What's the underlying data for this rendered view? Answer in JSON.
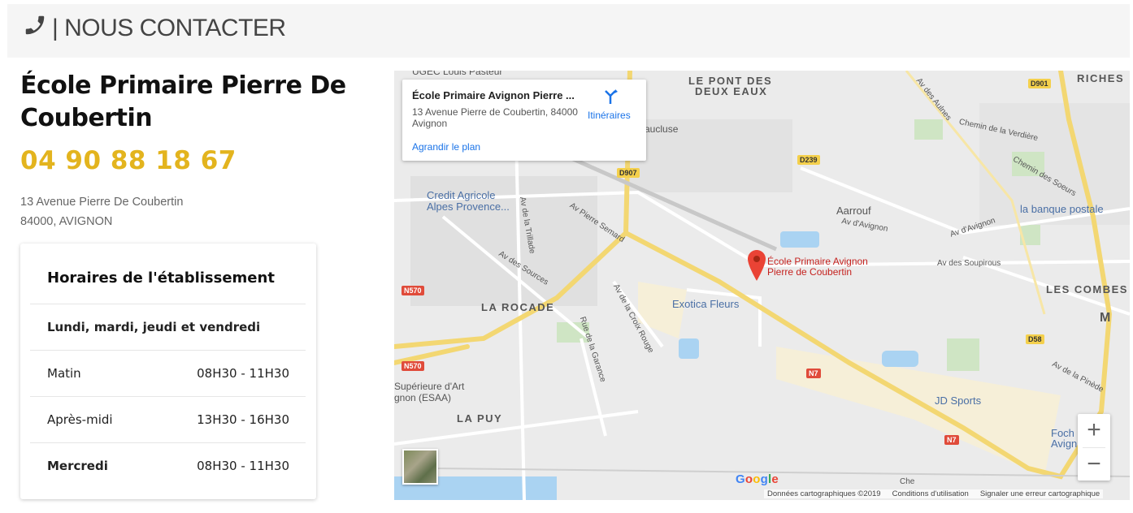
{
  "header": {
    "title": "| NOUS CONTACTER",
    "icon": "phone-icon"
  },
  "school": {
    "name": "École Primaire Pierre De Coubertin",
    "phone": "04 90 88 18 67",
    "address_line1": "13 Avenue Pierre De Coubertin",
    "address_line2": "84000, AVIGNON"
  },
  "hours": {
    "title": "Horaires de l'établissement",
    "section_label": "Lundi, mardi, jeudi et vendredi",
    "rows": [
      {
        "day": "Matin",
        "time": "08H30 - 11H30"
      },
      {
        "day": "Après-midi",
        "time": "13H30 - 16H30"
      },
      {
        "day": "Mercredi",
        "time": "08H30 - 11H30"
      }
    ]
  },
  "map": {
    "info_title": "École Primaire Avignon Pierre ...",
    "info_address": "13 Avenue Pierre de Coubertin, 84000 Avignon",
    "info_link": "Agrandir le plan",
    "directions_label": "Itinéraires",
    "pin_label_1": "École Primaire Avignon",
    "pin_label_2": "Pierre de Coubertin",
    "labels": {
      "le_pont": "LE PONT DES",
      "deux_eaux": "DEUX EAUX",
      "riches": "RICHES",
      "la_rocade": "LA ROCADE",
      "la_puy": "LA PUY",
      "les_combes": "LES COMBES",
      "ugec": "UGEC Louis Pasteur",
      "vaucluse": "aucluse",
      "credit1": "Credit Agricole",
      "credit2": "Alpes Provence...",
      "aarrouf": "Aarrouf",
      "banque": "la banque postale",
      "exotica": "Exotica Fleurs",
      "jd": "JD Sports",
      "foch1": "Foch",
      "foch2": "Avign",
      "esaa1": "Supérieure d'Art",
      "esaa2": "gnon (ESAA)",
      "av_aulnes": "Av des Aulnes",
      "ch_verdiere": "Chemin de la Verdière",
      "ch_soeurs": "Chemin des Soeurs",
      "av_avignon1": "Av d'Avignon",
      "av_avignon2": "Av d'Avignon",
      "av_soupirous": "Av des Soupirous",
      "av_semard": "Av Pierre Semard",
      "av_trillade": "Av de la Trillade",
      "av_sources": "Av des Sources",
      "av_croix": "Av de la Croix Rouge",
      "rue_garance": "Rue de la Garance",
      "av_pinede": "Av de la Pinède",
      "m": "M",
      "che": "Che"
    },
    "roads": [
      "D901",
      "D907",
      "D239",
      "N570",
      "N570",
      "N7",
      "N7",
      "D58"
    ],
    "google": "Google",
    "attribution": [
      "Données cartographiques ©2019",
      "Conditions d'utilisation",
      "Signaler une erreur cartographique"
    ]
  },
  "colors": {
    "accent": "#e3b41e",
    "link": "#1a73e8",
    "pin": "#ea4335"
  }
}
